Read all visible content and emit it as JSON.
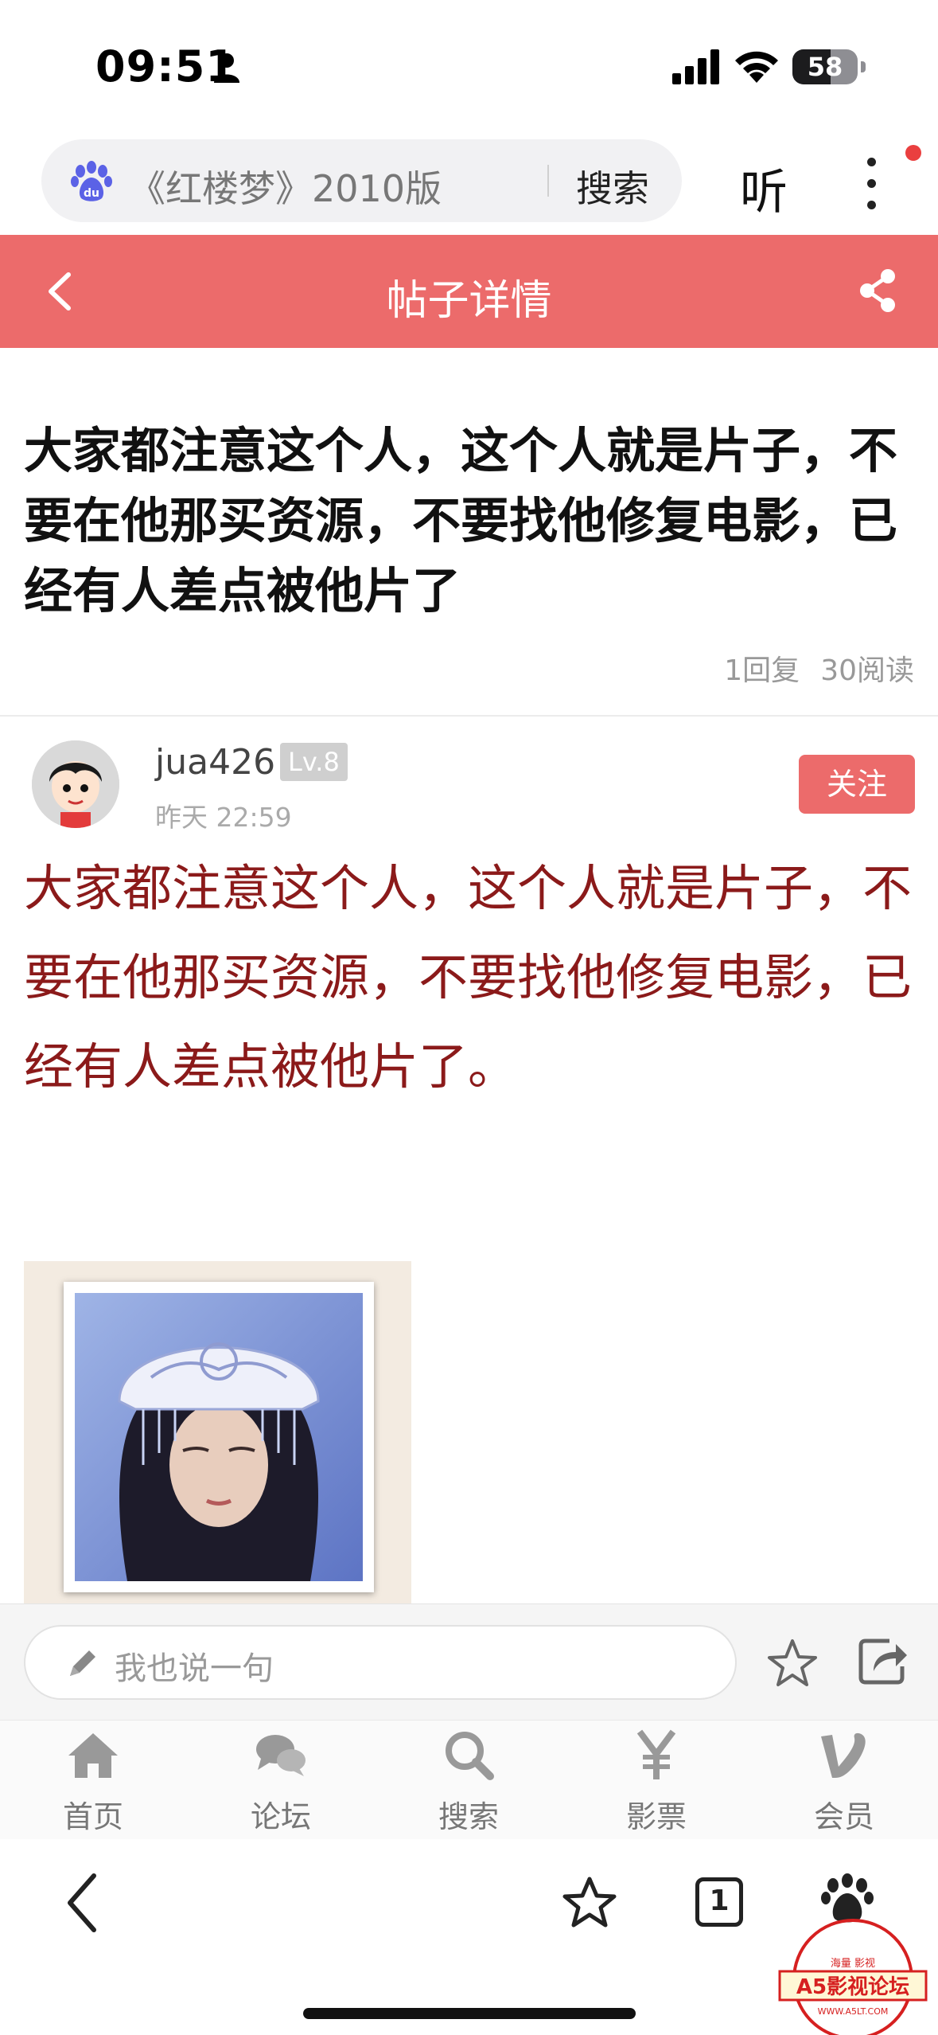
{
  "status_bar": {
    "time": "09:51",
    "battery": "58",
    "battery_level": 0.58
  },
  "search": {
    "query": "《红楼梦》2010版",
    "button": "搜索",
    "listen": "听"
  },
  "header": {
    "title": "帖子详情"
  },
  "post": {
    "title": "大家都注意这个人，这个人就是片子，不要在他那买资源，不要找他修复电影，已经有人差点被他片了",
    "replies": "1回复",
    "reads": "30阅读",
    "author": "jua426",
    "level": "Lv.8",
    "time": "昨天 22:59",
    "follow": "关注",
    "body": "大家都注意这个人，这个人就是片子，不要在他那买资源，不要找他修复电影，已经有人差点被他片了。"
  },
  "comment_bar": {
    "placeholder": "我也说一句"
  },
  "tabs": [
    {
      "label": "首页",
      "icon": "home-icon"
    },
    {
      "label": "论坛",
      "icon": "chat-icon"
    },
    {
      "label": "搜索",
      "icon": "search-icon"
    },
    {
      "label": "影票",
      "icon": "yen-icon"
    },
    {
      "label": "会员",
      "icon": "vip-icon"
    }
  ],
  "browser": {
    "tab_count": "1"
  },
  "watermark": {
    "top_text": "海量 影视",
    "main": "A5影视论坛",
    "url": "WWW.A5LT.COM"
  },
  "colors": {
    "accent": "#ec6b6b",
    "body_text": "#8b1a1a"
  }
}
